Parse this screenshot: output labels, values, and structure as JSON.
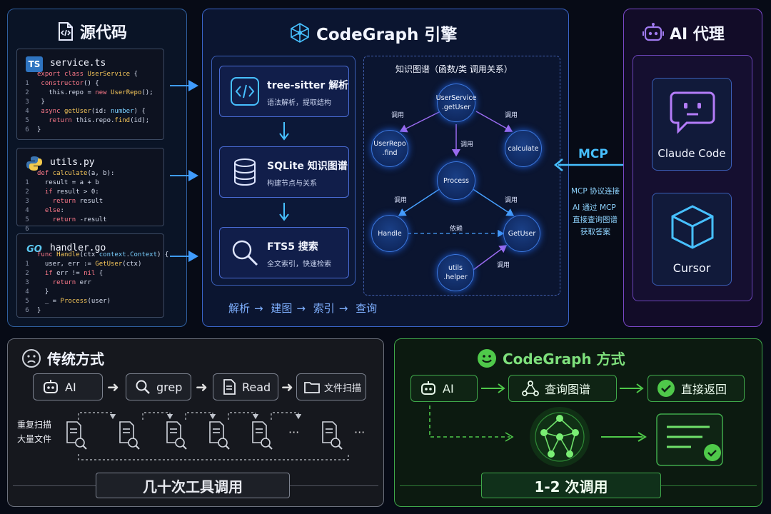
{
  "source": {
    "title": "源代码",
    "files": [
      {
        "badge": "TS",
        "name": "service.ts",
        "lines": [
          {
            "n": "",
            "code": "export class UserService {"
          },
          {
            "n": "1",
            "code": " constructor() {"
          },
          {
            "n": "2",
            "code": "   this.repo = new UserRepo();"
          },
          {
            "n": "3",
            "code": " }"
          },
          {
            "n": "4",
            "code": " async getUser(id: number) {"
          },
          {
            "n": "5",
            "code": "   return this.repo.find(id);"
          },
          {
            "n": "6",
            "code": "}"
          }
        ]
      },
      {
        "badge": "",
        "name": "utils.py",
        "lines": [
          {
            "n": "",
            "code": "def calculate(a, b):"
          },
          {
            "n": "1",
            "code": "  result = a + b"
          },
          {
            "n": "2",
            "code": "  if result > 0:"
          },
          {
            "n": "3",
            "code": "    return result"
          },
          {
            "n": "4",
            "code": "  else:"
          },
          {
            "n": "5",
            "code": "    return -result"
          },
          {
            "n": "6",
            "code": ""
          }
        ]
      },
      {
        "badge": "GO",
        "name": "handler.go",
        "lines": [
          {
            "n": "",
            "code": "func Handle(ctx context.Context) {"
          },
          {
            "n": "1",
            "code": "  user, err := GetUser(ctx)"
          },
          {
            "n": "2",
            "code": "  if err != nil {"
          },
          {
            "n": "3",
            "code": "    return err"
          },
          {
            "n": "4",
            "code": "  }"
          },
          {
            "n": "5",
            "code": "  _ = Process(user)"
          },
          {
            "n": "6",
            "code": "}"
          }
        ]
      }
    ]
  },
  "engine": {
    "title": "CodeGraph 引擎",
    "steps": [
      {
        "title": "tree-sitter 解析",
        "desc": "语法解析，提取结构",
        "icon": "code-icon"
      },
      {
        "title": "SQLite 知识图谱",
        "desc": "构建节点与关系",
        "icon": "database-icon"
      },
      {
        "title": "FTS5 搜索",
        "desc": "全文索引，快速检索",
        "icon": "search-icon"
      }
    ],
    "flow": [
      "解析",
      "建图",
      "索引",
      "查询"
    ],
    "graph": {
      "title": "知识图谱（函数/类 调用关系）",
      "nodes": {
        "userservice": "UserService\n.getUser",
        "userrepo": "UserRepo\n.find",
        "calculate": "calculate",
        "process": "Process",
        "handle": "Handle",
        "getuser": "GetUser",
        "utils": "utils\n.helper"
      },
      "edges": {
        "call": "调用",
        "depends": "依赖"
      }
    }
  },
  "mcp": {
    "title": "MCP",
    "sub1": "MCP 协议连接",
    "sub2": "AI 通过 MCP",
    "sub3": "直接查询图谱",
    "sub4": "获取答案"
  },
  "ai": {
    "title": "AI 代理",
    "agents": [
      "Claude Code",
      "Cursor"
    ]
  },
  "traditional": {
    "title": "传统方式",
    "steps": [
      "AI",
      "grep",
      "Read",
      "文件扫描"
    ],
    "side_label_1": "重复扫描",
    "side_label_2": "大量文件",
    "ellipsis": "···",
    "result": "几十次工具调用"
  },
  "codegraph": {
    "title": "CodeGraph 方式",
    "steps": [
      "AI",
      "查询图谱",
      "直接返回"
    ],
    "result": "1-2 次调用"
  },
  "colors": {
    "accent_blue": "#3b78e0",
    "accent_green": "#3fa84a",
    "accent_purple": "#7a48c8",
    "mcp_cyan": "#47c0ff"
  }
}
